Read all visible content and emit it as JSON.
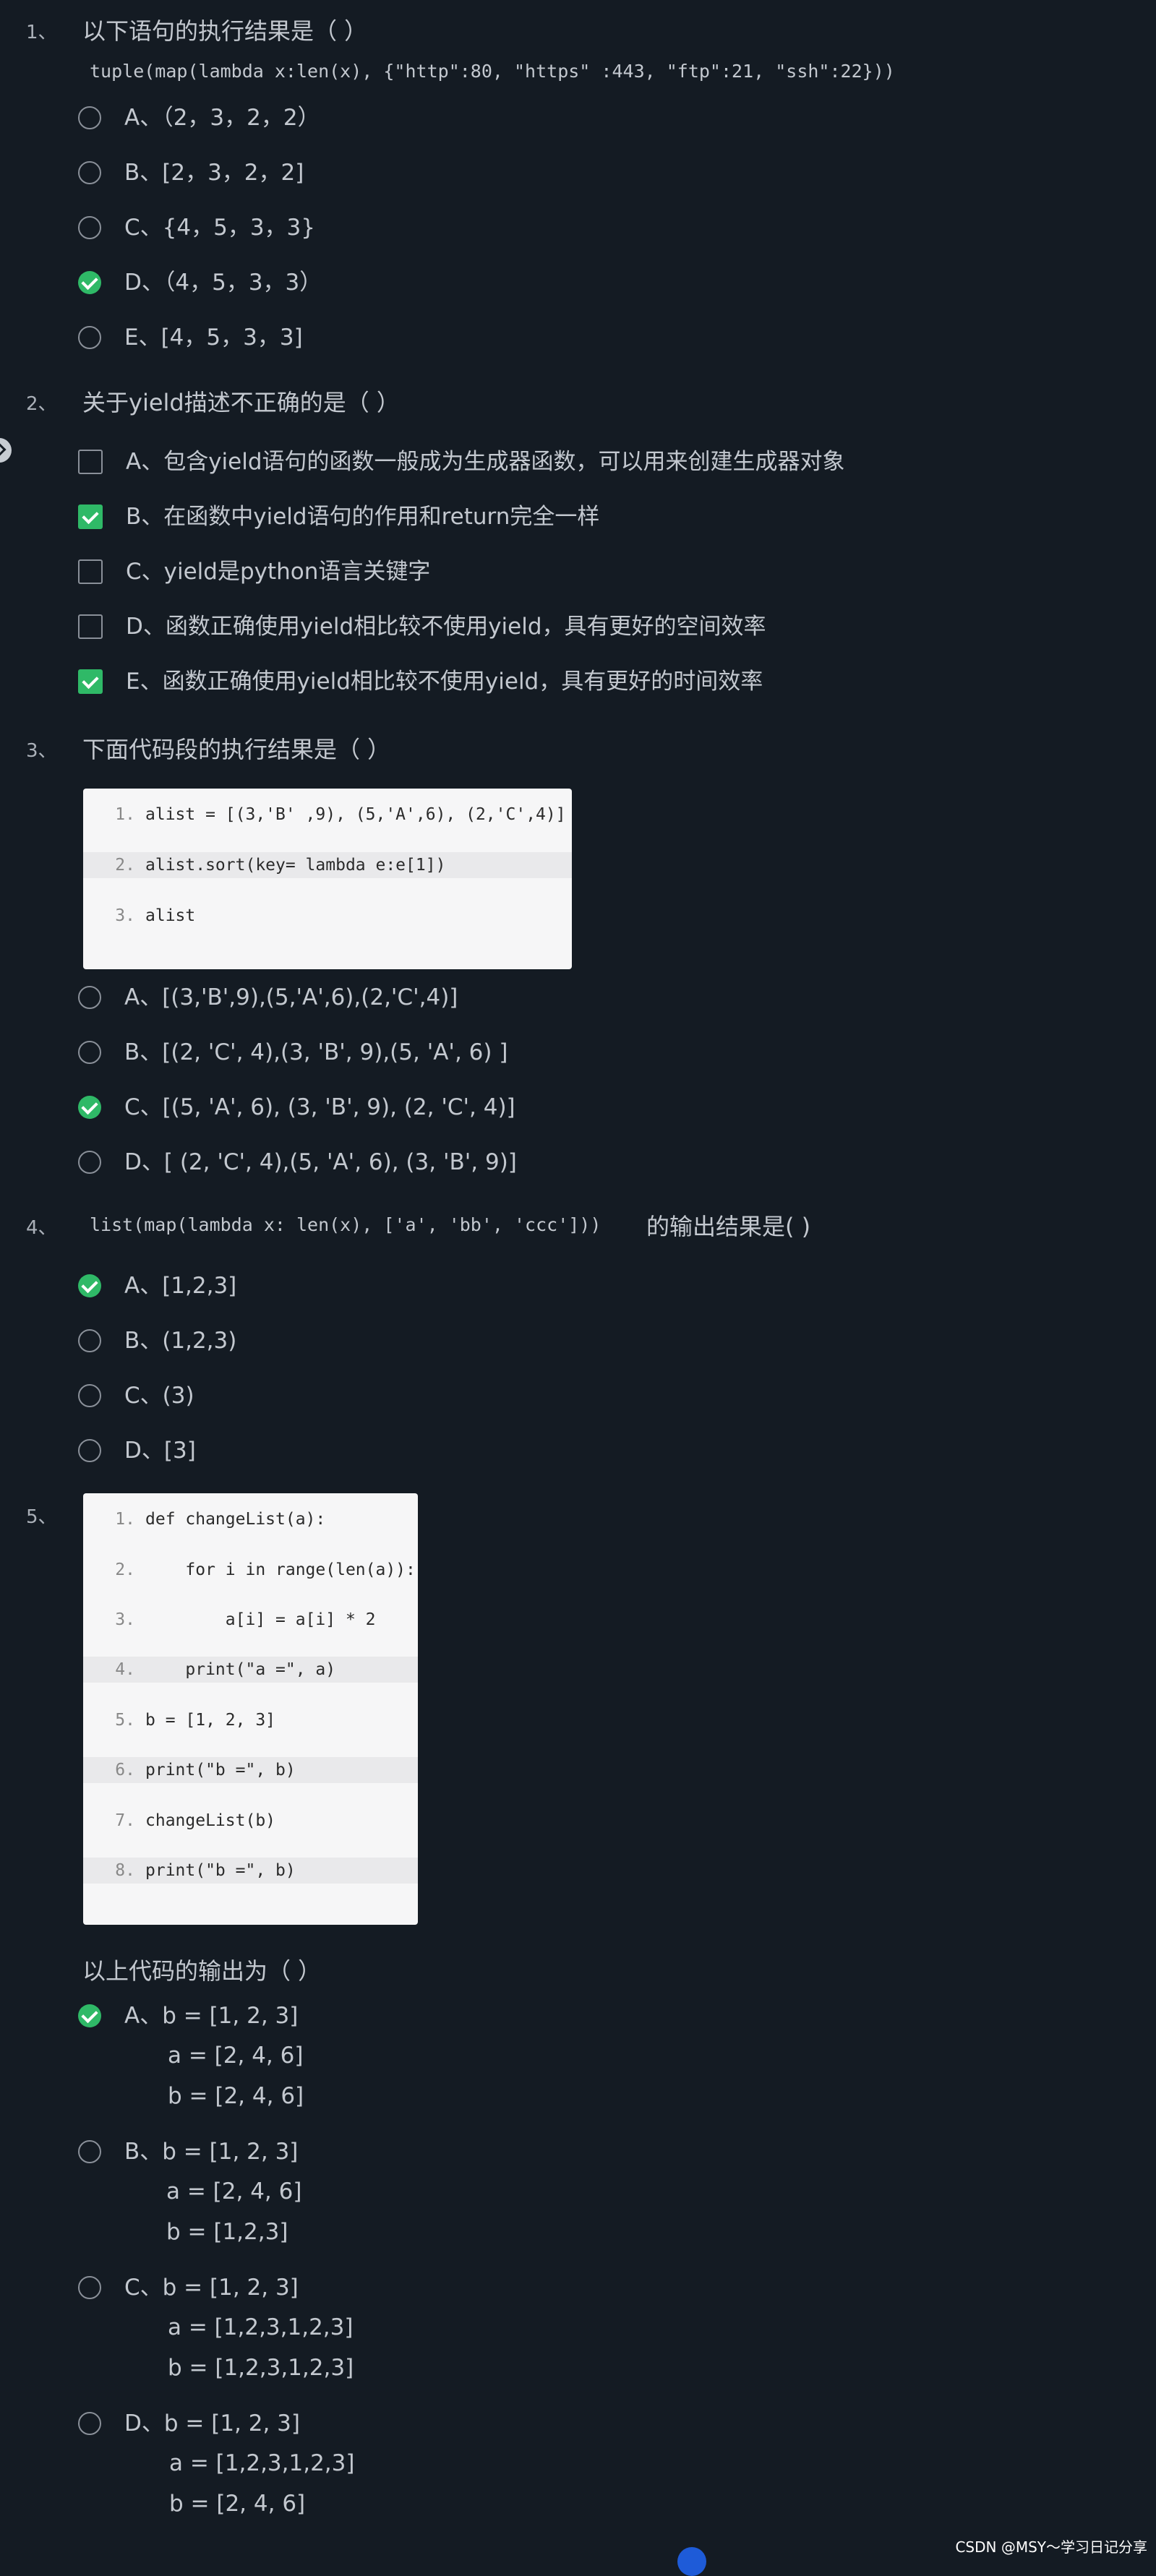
{
  "questions": [
    {
      "num": "1、",
      "text": "以下语句的执行结果是（ ）",
      "code_line": "tuple(map(lambda x:len(x), {\"http\":80, \"https\" :443, \"ftp\":21, \"ssh\":22}))",
      "options": [
        "A、（2，3，2，2）",
        "B、[2，3，2，2]",
        "C、{4，5，3，3}",
        "D、（4，5，3，3）",
        "E、[4，5，3，3]"
      ],
      "selected": "D"
    },
    {
      "num": "2、",
      "text": "关于yield描述不正确的是（ ）",
      "options": [
        "A、包含yield语句的函数一般成为生成器函数，可以用来创建生成器对象",
        "B、在函数中yield语句的作用和return完全一样",
        "C、yield是python语言关键字",
        "D、函数正确使用yield相比较不使用yield，具有更好的空间效率",
        "E、函数正确使用yield相比较不使用yield，具有更好的时间效率"
      ],
      "selected": [
        "B",
        "E"
      ]
    },
    {
      "num": "3、",
      "text": "下面代码段的执行结果是（ ）",
      "code": [
        {
          "n": "1.",
          "t": "alist = [(3,'B' ,9), (5,'A',6), (2,'C',4)]"
        },
        {
          "n": "2.",
          "t": "alist.sort(key= lambda e:e[1])"
        },
        {
          "n": "3.",
          "t": "alist"
        }
      ],
      "options": [
        "A、[(3,'B',9),(5,'A',6),(2,'C',4)]",
        "B、[(2, 'C', 4),(3, 'B', 9),(5, 'A', 6) ]",
        "C、[(5, 'A', 6), (3, 'B', 9), (2, 'C', 4)]",
        "D、[ (2, 'C', 4),(5, 'A', 6), (3, 'B', 9)]"
      ],
      "selected": "C"
    },
    {
      "num": "4、",
      "code_inline": "list(map(lambda x: len(x), ['a', 'bb', 'ccc']))",
      "text": "的输出结果是( )",
      "options": [
        "A、[1,2,3]",
        "B、(1,2,3)",
        "C、(3)",
        "D、[3]"
      ],
      "selected": "A"
    },
    {
      "num": "5、",
      "code": [
        {
          "n": "1.",
          "t": "def changeList(a):"
        },
        {
          "n": "2.",
          "t": "    for i in range(len(a)):"
        },
        {
          "n": "3.",
          "t": "        a[i] = a[i] * 2"
        },
        {
          "n": "4.",
          "t": "    print(\"a =\", a)"
        },
        {
          "n": "5.",
          "t": "b = [1, 2, 3]"
        },
        {
          "n": "6.",
          "t": "print(\"b =\", b)"
        },
        {
          "n": "7.",
          "t": "changeList(b)"
        },
        {
          "n": "8.",
          "t": "print(\"b =\", b)"
        }
      ],
      "text": "以上代码的输出为（ ）",
      "options": [
        {
          "l1": "A、b = [1, 2, 3]",
          "l2": "a = [2, 4, 6]",
          "l3": "b = [2, 4, 6]"
        },
        {
          "l1": "B、b = [1, 2, 3]",
          "l2": "a = [2, 4, 6]",
          "l3": "b = [1,2,3]"
        },
        {
          "l1": "C、b = [1, 2, 3]",
          "l2": "a = [1,2,3,1,2,3]",
          "l3": "b = [1,2,3,1,2,3]"
        },
        {
          "l1": "D、b = [1, 2, 3]",
          "l2": "a = [1,2,3,1,2,3]",
          "l3": "b = [2, 4, 6]"
        }
      ],
      "selected": "A"
    }
  ],
  "watermark": "CSDN @MSY～学习日记分享",
  "colors": {
    "background": "#141b23",
    "selected": "#2fb967",
    "code_bg": "#f6f6f7"
  }
}
